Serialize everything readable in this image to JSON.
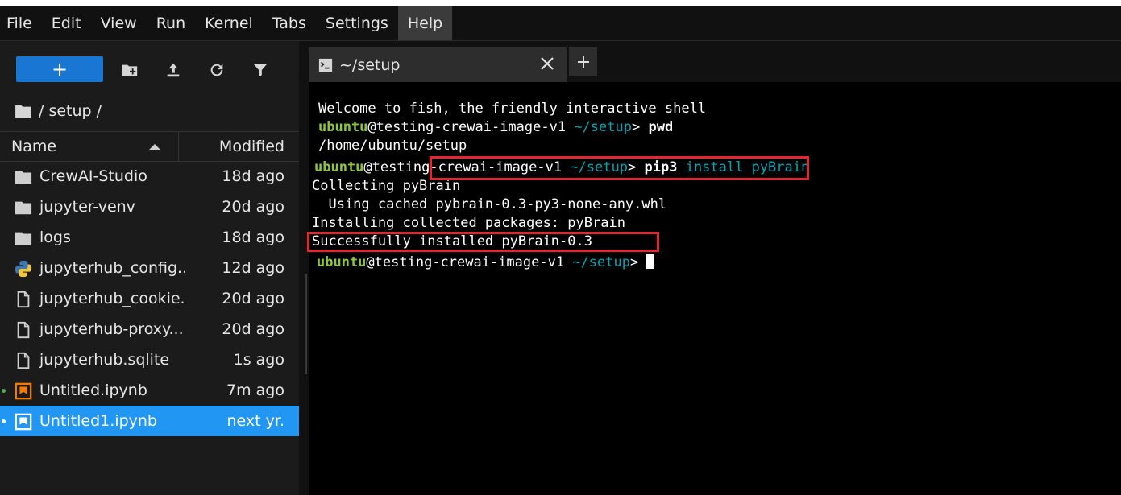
{
  "menu": [
    "File",
    "Edit",
    "View",
    "Run",
    "Kernel",
    "Tabs",
    "Settings",
    "Help"
  ],
  "menu_active": "Help",
  "toolbar": {
    "new_label": "+",
    "icons": [
      "new-folder-icon",
      "upload-icon",
      "refresh-icon",
      "filter-icon"
    ]
  },
  "breadcrumb": "/ setup /",
  "list_header": {
    "name": "Name",
    "modified": "Modified"
  },
  "files": [
    {
      "name": "CrewAI-Studio",
      "modified": "18d ago",
      "icon": "folder-icon"
    },
    {
      "name": "jupyter-venv",
      "modified": "20d ago",
      "icon": "folder-icon"
    },
    {
      "name": "logs",
      "modified": "18d ago",
      "icon": "folder-icon"
    },
    {
      "name": "jupyterhub_config...",
      "modified": "12d ago",
      "icon": "python-file-icon"
    },
    {
      "name": "jupyterhub_cookie...",
      "modified": "20d ago",
      "icon": "file-icon"
    },
    {
      "name": "jupyterhub-proxy....",
      "modified": "20d ago",
      "icon": "file-icon"
    },
    {
      "name": "jupyterhub.sqlite",
      "modified": "1s ago",
      "icon": "file-icon"
    },
    {
      "name": "Untitled.ipynb",
      "modified": "7m ago",
      "icon": "notebook-icon"
    },
    {
      "name": "Untitled1.ipynb",
      "modified": "next yr.",
      "icon": "notebook-icon"
    }
  ],
  "tab": {
    "title": "~/setup",
    "add_label": "+"
  },
  "terminal": {
    "welcome": "Welcome to fish, the friendly interactive shell",
    "user": "ubuntu",
    "at": "@",
    "host": "testing-crewai-image-v1",
    "host_part1": "testing",
    "host_part2": "-crewai-image-v1",
    "cwd": "~/setup",
    "prompt_char": ">",
    "cmd1": "pwd",
    "out1": "/home/ubuntu/setup",
    "cmd2_bin": "pip3",
    "cmd2_args": "install pyBrain",
    "out2": "Collecting pyBrain",
    "out3": "  Using cached pybrain-0.3-py3-none-any.whl",
    "out4": "Installing collected packages: pyBrain",
    "out5": "Successfully installed pyBrain-0.3"
  },
  "colors": {
    "accent": "#2196f3",
    "new_button": "#1976d2",
    "prompt_user": "#8ec73c",
    "prompt_path": "#00a6b2",
    "highlight_box": "#e3262f"
  }
}
